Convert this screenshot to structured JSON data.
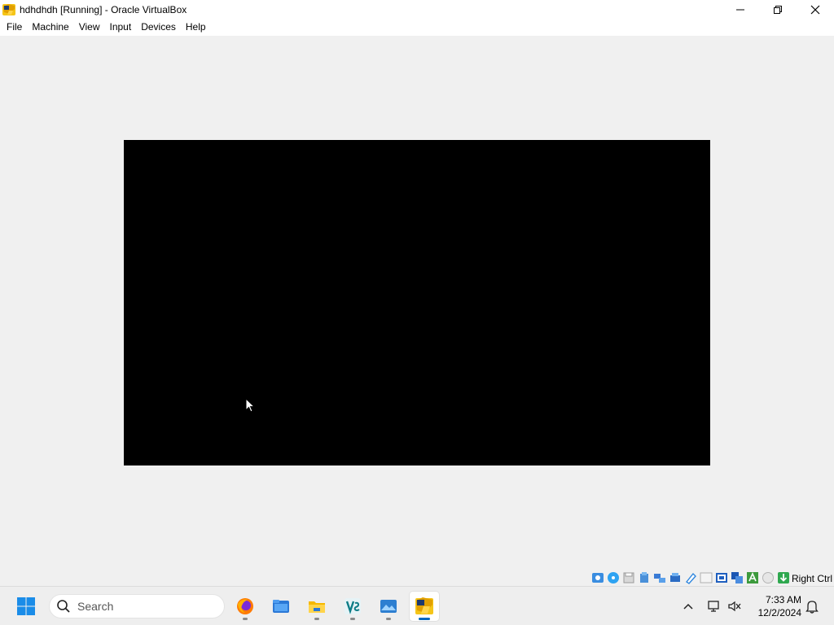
{
  "window": {
    "title": "hdhdhdh [Running] - Oracle VirtualBox",
    "controls": [
      "minimize",
      "restore",
      "close"
    ]
  },
  "menu": {
    "items": [
      "File",
      "Machine",
      "View",
      "Input",
      "Devices",
      "Help"
    ]
  },
  "vm": {
    "screen_color": "#000000",
    "background_color": "#f0f0f0"
  },
  "statusbar": {
    "icons": [
      "hard-disk-icon",
      "optical-disk-icon",
      "floppy-icon",
      "audio-icon",
      "network-icon",
      "usb-icon",
      "shared-folders-icon",
      "display-icon",
      "recording-icon",
      "cpu-icon",
      "mouse-integration-icon",
      "keyboard-icon"
    ],
    "host_key": "Right Ctrl"
  },
  "taskbar": {
    "search_label": "Search",
    "apps": [
      {
        "name": "firefox-app",
        "icon": "firefox-icon"
      },
      {
        "name": "explorer-app",
        "icon": "folder-icon"
      },
      {
        "name": "file-explorer-app",
        "icon": "file-explorer-icon"
      },
      {
        "name": "vscode-app",
        "icon": "vs-icon"
      },
      {
        "name": "photos-app",
        "icon": "photos-icon"
      },
      {
        "name": "virtualbox-app",
        "icon": "virtualbox-icon",
        "active": true
      }
    ],
    "clock_time": "7:33 AM",
    "clock_date": "12/2/2024"
  },
  "colors": {
    "accent": "#0067c0",
    "taskbar": "#eeeeee",
    "titlebar": "#ffffff"
  }
}
